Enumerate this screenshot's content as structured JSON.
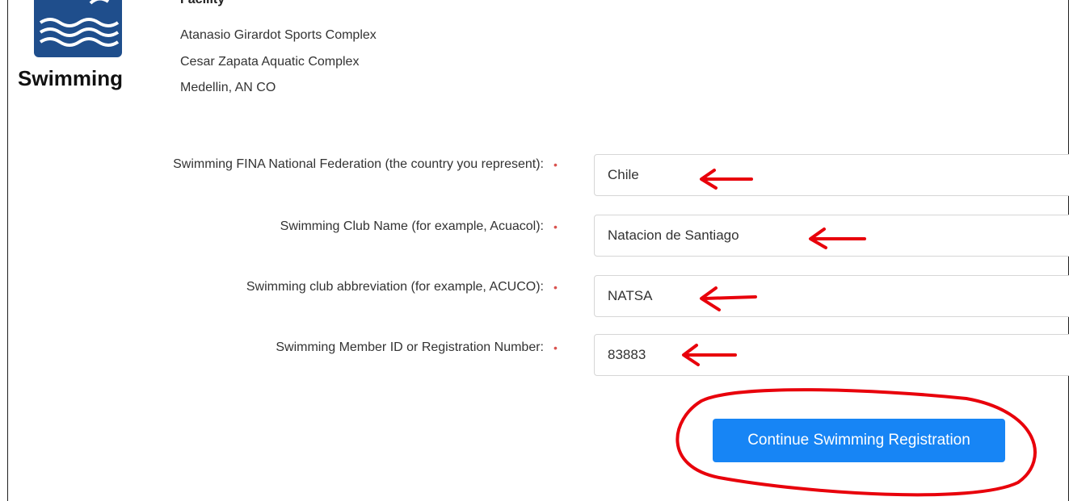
{
  "sport": {
    "name": "Swimming",
    "logo_icon": "swimming-waves-icon",
    "logo_color": "#1f4e8c"
  },
  "facility": {
    "heading": "Facility",
    "lines": [
      "Atanasio Girardot Sports Complex",
      "Cesar Zapata Aquatic Complex",
      "Medellin, AN CO"
    ]
  },
  "form": {
    "required_marker": "•",
    "fields": [
      {
        "label": "Swimming FINA National Federation (the country you represent):",
        "value": "Chile"
      },
      {
        "label": "Swimming Club Name (for example, Acuacol):",
        "value": "Natacion de Santiago"
      },
      {
        "label": "Swimming club abbreviation (for example, ACUCO):",
        "value": "NATSA"
      },
      {
        "label": "Swimming Member ID or Registration Number:",
        "value": "83883"
      }
    ],
    "submit_label": "Continue Swimming Registration"
  },
  "colors": {
    "accent": "#1785f5",
    "required": "#d9534f",
    "annotation": "#e8000b"
  }
}
